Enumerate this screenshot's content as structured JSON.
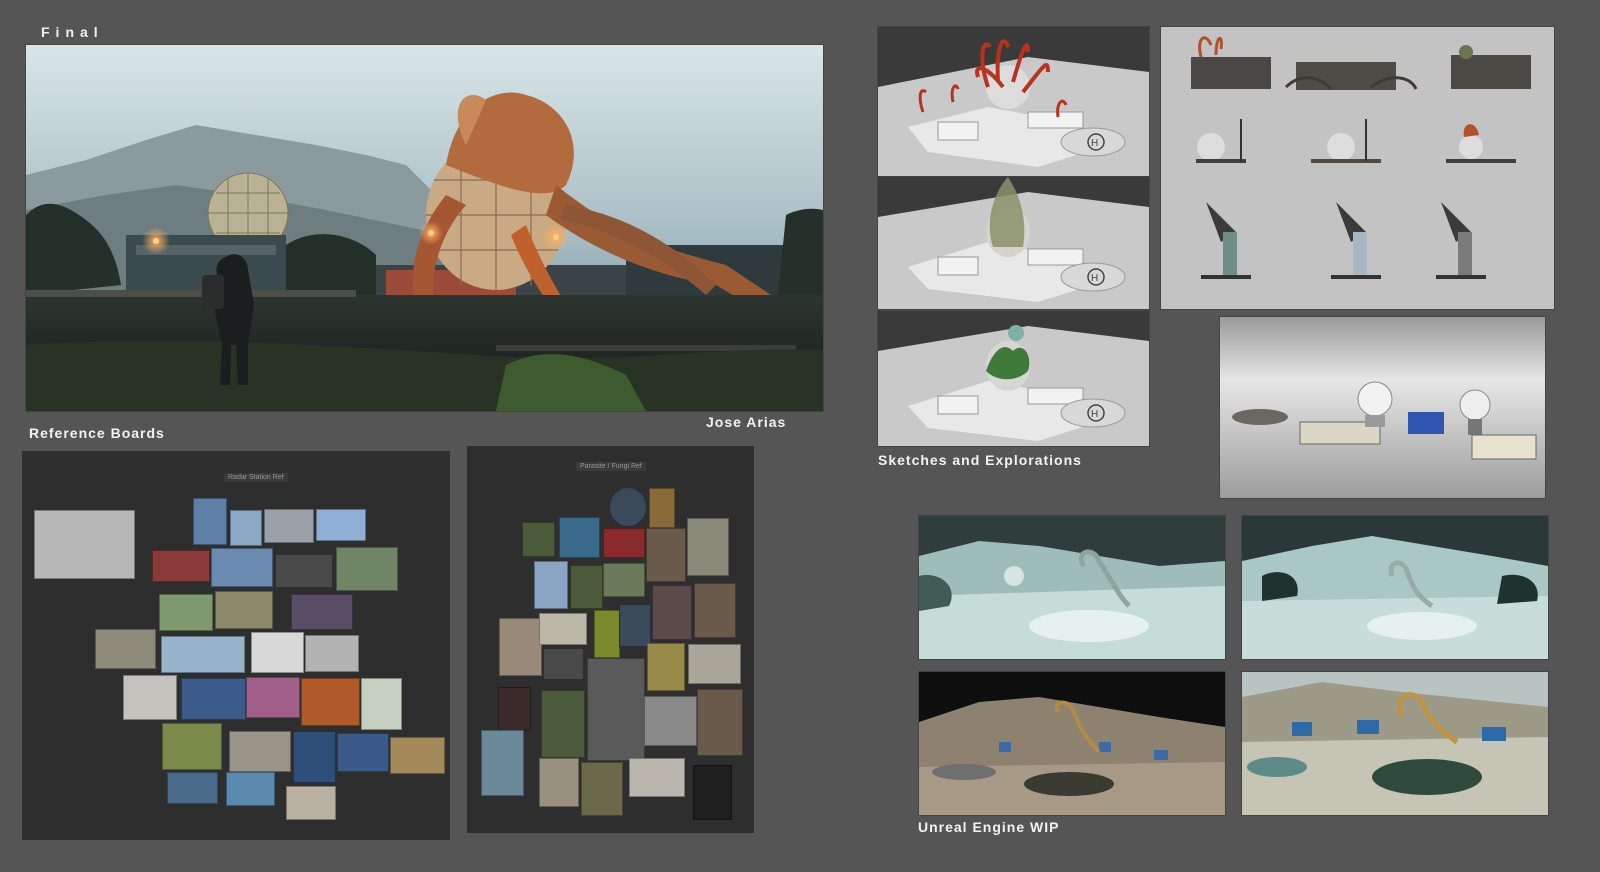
{
  "labels": {
    "final": "Final",
    "artist": "Jose Arias",
    "reference_boards": "Reference Boards",
    "sketches": "Sketches and Explorations",
    "unreal": "Unreal Engine WIP"
  },
  "boards": {
    "radar": "Radar Station Ref",
    "parasite": "Parasite / Fungi Ref"
  },
  "colors": {
    "background": "#555555",
    "board_panel": "#2e2e2e",
    "sky": "#b9ccd3",
    "creature_orange": "#c0602c",
    "render_grey": "#c9c9c9",
    "ue_teal": "#a9c8c5",
    "ue_sand": "#8d8170"
  }
}
